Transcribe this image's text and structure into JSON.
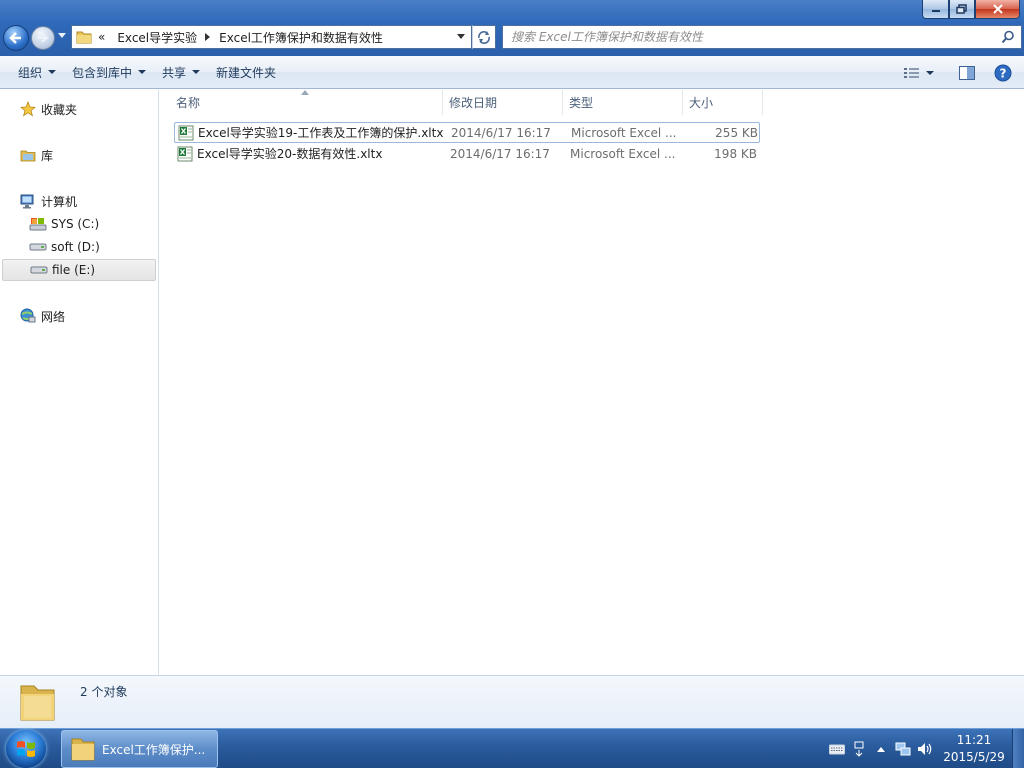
{
  "window": {
    "address": {
      "overflow_glyph": "«",
      "crumbs": [
        "Excel导学实验",
        "Excel工作簿保护和数据有效性"
      ]
    },
    "search": {
      "placeholder": "搜索 Excel工作簿保护和数据有效性"
    }
  },
  "toolbar": {
    "organize": "组织",
    "include_in_library": "包含到库中",
    "share": "共享",
    "new_folder": "新建文件夹"
  },
  "navigation": {
    "favorites": "收藏夹",
    "libraries": "库",
    "computer": "计算机",
    "drives": [
      "SYS (C:)",
      "soft (D:)",
      "file (E:)"
    ],
    "network": "网络"
  },
  "columns": {
    "name": "名称",
    "date": "修改日期",
    "type": "类型",
    "size": "大小"
  },
  "files": [
    {
      "name": "Excel导学实验19-工作表及工作簿的保护.xltx",
      "date": "2014/6/17 16:17",
      "type": "Microsoft Excel ...",
      "size": "255 KB"
    },
    {
      "name": "Excel导学实验20-数据有效性.xltx",
      "date": "2014/6/17 16:17",
      "type": "Microsoft Excel ...",
      "size": "198 KB"
    }
  ],
  "details": {
    "count": "2 个对象"
  },
  "taskbar": {
    "active_window": "Excel工作簿保护...",
    "time": "11:21",
    "date": "2015/5/29"
  },
  "colors": {
    "title_bar": "#2f69b9",
    "command_bar": "#e3ecf7",
    "taskbar": "#2a5b9c",
    "selection_border": "#99b8dc"
  },
  "icons": {
    "back": "back-arrow-icon",
    "forward": "forward-arrow-icon",
    "search": "search-icon",
    "favorites": "star-icon",
    "libraries": "library-icon",
    "computer": "computer-icon",
    "drive": "drive-icon",
    "network": "network-icon",
    "file": "excel-template-icon"
  }
}
